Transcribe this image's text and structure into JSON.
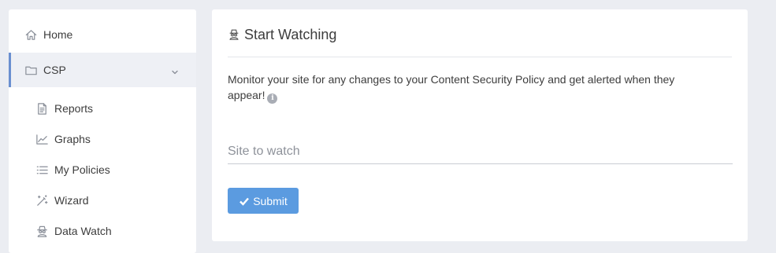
{
  "sidebar": {
    "items": [
      {
        "label": "Home",
        "icon": "home-icon"
      },
      {
        "label": "CSP",
        "icon": "folder-icon",
        "expanded": true
      },
      {
        "label": "Reports",
        "icon": "document-icon"
      },
      {
        "label": "Graphs",
        "icon": "chart-line-icon"
      },
      {
        "label": "My Policies",
        "icon": "list-icon"
      },
      {
        "label": "Wizard",
        "icon": "magic-wand-icon"
      },
      {
        "label": "Data Watch",
        "icon": "spy-icon"
      }
    ]
  },
  "main": {
    "title": "Start Watching",
    "title_icon": "spy-icon",
    "description": "Monitor your site for any changes to your Content Security Policy and get alerted when they appear!",
    "info_glyph": "i",
    "site_input": {
      "placeholder": "Site to watch",
      "value": ""
    },
    "submit_label": "Submit"
  },
  "colors": {
    "background": "#ebedf2",
    "accent": "#5b9be0",
    "active_border": "#6a8fd0"
  }
}
